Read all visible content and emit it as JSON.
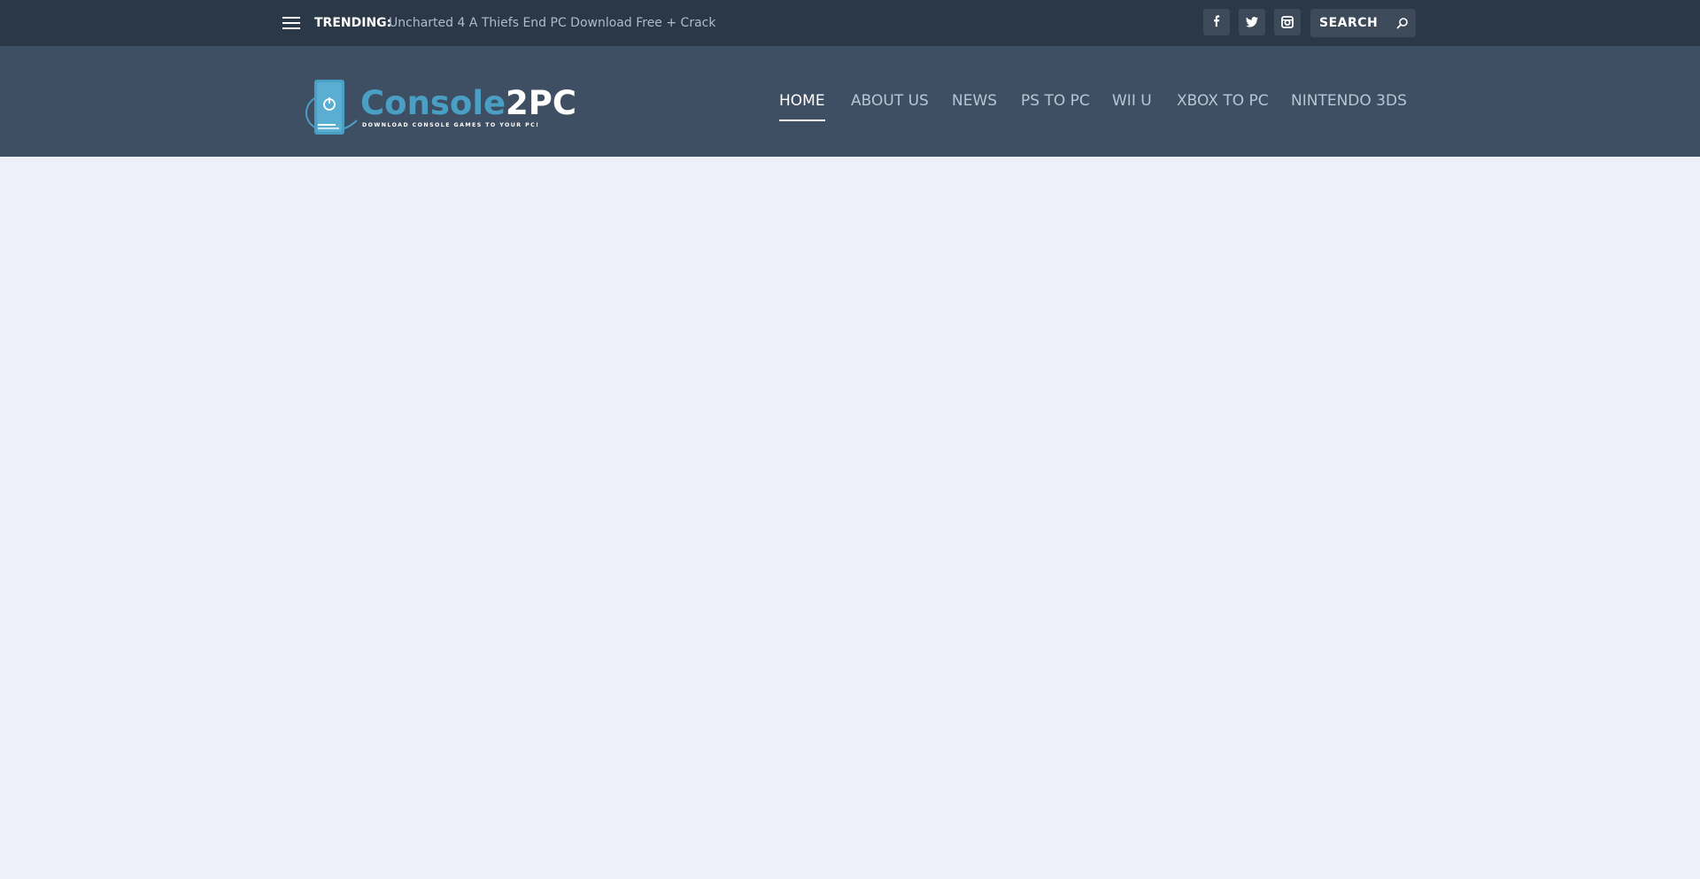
{
  "topbar": {
    "trending_label": "TRENDING:",
    "trending_link": "Uncharted 4 A Thiefs End PC Download Free + Crack",
    "social": [
      "facebook-icon",
      "twitter-icon",
      "instagram-icon"
    ],
    "search_placeholder": "SEARCH"
  },
  "header": {
    "logo_text": "Console2PC",
    "logo_tagline": "DOWNLOAD CONSOLE GAMES TO YOUR PC!",
    "nav": [
      {
        "label": "HOME",
        "active": true
      },
      {
        "label": "ABOUT US"
      },
      {
        "label": "NEWS"
      },
      {
        "label": "PS TO PC"
      },
      {
        "label": "WII U"
      },
      {
        "label": "XBOX TO PC"
      },
      {
        "label": "NINTENDO 3DS"
      }
    ]
  },
  "colors": {
    "topbar_bg": "#2b3847",
    "header_bg": "#3f4f63",
    "content_bg": "#edf0f8",
    "logo_blue": "#4a9fc4"
  }
}
